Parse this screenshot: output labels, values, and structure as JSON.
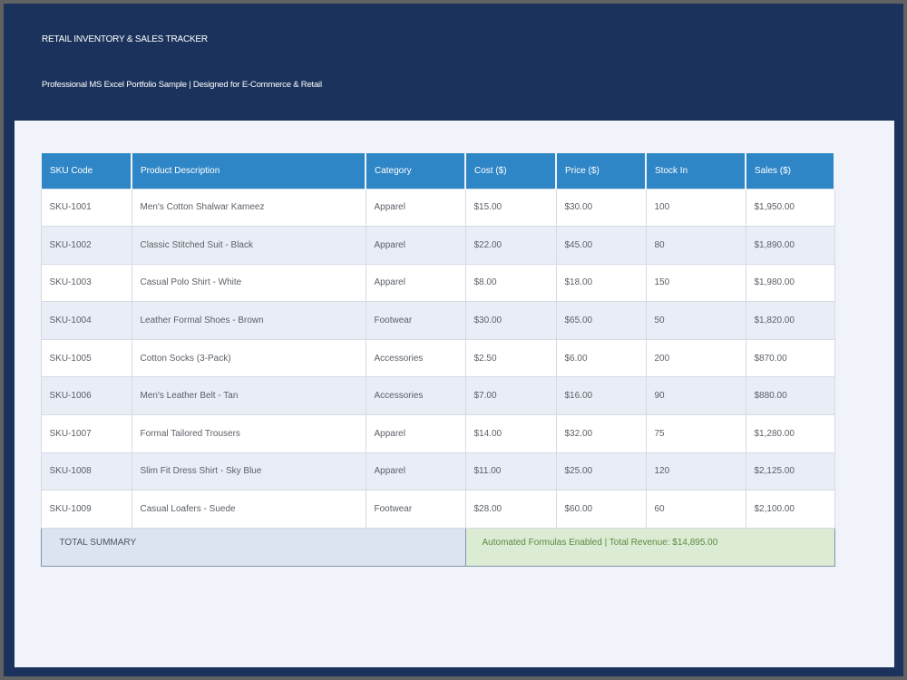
{
  "header": {
    "title": "RETAIL INVENTORY & SALES TRACKER",
    "subtitle": "Professional MS Excel Portfolio Sample | Designed for E-Commerce & Retail"
  },
  "table": {
    "columns": [
      "SKU Code",
      "Product Description",
      "Category",
      "Cost ($)",
      "Price ($)",
      "Stock In",
      "Sales ($)"
    ],
    "rows": [
      [
        "SKU-1001",
        "Men's Cotton Shalwar Kameez",
        "Apparel",
        "$15.00",
        "$30.00",
        "100",
        "$1,950.00"
      ],
      [
        "SKU-1002",
        "Classic Stitched Suit - Black",
        "Apparel",
        "$22.00",
        "$45.00",
        "80",
        "$1,890.00"
      ],
      [
        "SKU-1003",
        "Casual Polo Shirt - White",
        "Apparel",
        "$8.00",
        "$18.00",
        "150",
        "$1,980.00"
      ],
      [
        "SKU-1004",
        "Leather Formal Shoes - Brown",
        "Footwear",
        "$30.00",
        "$65.00",
        "50",
        "$1,820.00"
      ],
      [
        "SKU-1005",
        "Cotton Socks (3-Pack)",
        "Accessories",
        "$2.50",
        "$6.00",
        "200",
        "$870.00"
      ],
      [
        "SKU-1006",
        "Men's Leather Belt - Tan",
        "Accessories",
        "$7.00",
        "$16.00",
        "90",
        "$880.00"
      ],
      [
        "SKU-1007",
        "Formal Tailored Trousers",
        "Apparel",
        "$14.00",
        "$32.00",
        "75",
        "$1,280.00"
      ],
      [
        "SKU-1008",
        "Slim Fit Dress Shirt - Sky Blue",
        "Apparel",
        "$11.00",
        "$25.00",
        "120",
        "$2,125.00"
      ],
      [
        "SKU-1009",
        "Casual Loafers - Suede",
        "Footwear",
        "$28.00",
        "$60.00",
        "60",
        "$2,100.00"
      ]
    ],
    "summary": {
      "label": "TOTAL SUMMARY",
      "info": "Automated Formulas Enabled | Total Revenue: $14,895.00"
    }
  },
  "colors": {
    "banner": "#1b335c",
    "header_cell": "#2f86c6",
    "summary_label_bg": "#dbe5f1",
    "summary_info_bg": "#dcebd3"
  }
}
